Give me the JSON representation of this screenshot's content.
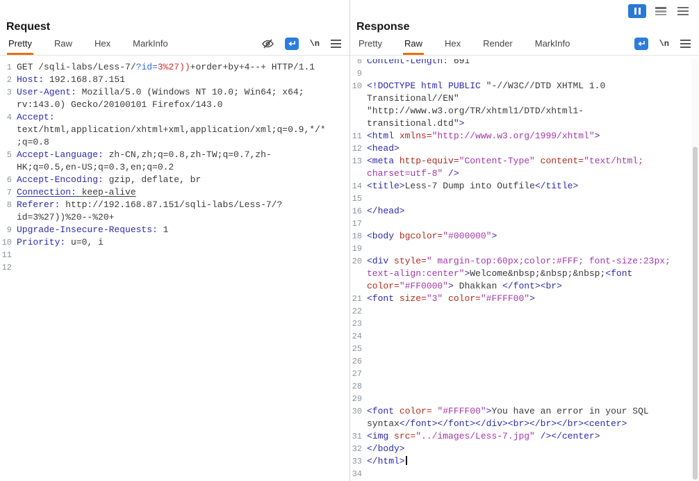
{
  "window": {
    "controls": {
      "pause_icon": "pause-icon",
      "layout_icon": "layout-rows-icon",
      "menu_icon": "menu-icon",
      "pause_button_bg": "#2878d8"
    }
  },
  "colors": {
    "tab_active_underline": "#e8700e",
    "wrap_icon_bg": "#2b7de0",
    "header_name": "#2b2bb0",
    "tag": "#2b2bb0",
    "attribute": "#b22a1d",
    "string": "#a437ad",
    "param_name": "#2f6fd3",
    "param_value": "#d22d2d",
    "plain_text": "#3a3a3a",
    "line_number": "#8d95a0"
  },
  "request": {
    "title": "Request",
    "tabs": [
      {
        "label": "Pretty",
        "active": true
      },
      {
        "label": "Raw",
        "active": false
      },
      {
        "label": "Hex",
        "active": false
      },
      {
        "label": "MarkInfo",
        "active": false
      }
    ],
    "toolbar": {
      "icons": [
        "eye-off-icon",
        "wrap-icon",
        "newline-icon",
        "menu-icon"
      ],
      "newline_label": "\\n"
    },
    "lines": [
      {
        "n": "1",
        "segs": [
          {
            "t": "GET /sqli-labs/Less-7/",
            "c": "plain"
          },
          {
            "t": "?id=",
            "c": "pname"
          },
          {
            "t": "3%27))",
            "c": "pvalue"
          },
          {
            "t": "+order+by+4--+ HTTP/1.1",
            "c": "plain"
          }
        ]
      },
      {
        "n": "2",
        "segs": [
          {
            "t": "Host:",
            "c": "hname"
          },
          {
            "t": " 192.168.87.151",
            "c": "plain"
          }
        ]
      },
      {
        "n": "3",
        "segs": [
          {
            "t": "User-Agent:",
            "c": "hname"
          },
          {
            "t": " Mozilla/5.0 (Windows NT 10.0; Win64; x64; rv:143.0) Gecko/20100101 Firefox/143.0",
            "c": "plain"
          }
        ]
      },
      {
        "n": "4",
        "segs": [
          {
            "t": "Accept:",
            "c": "hname"
          },
          {
            "t": " text/html,application/xhtml+xml,application/xml;q=0.9,*/*;q=0.8",
            "c": "plain"
          }
        ]
      },
      {
        "n": "5",
        "segs": [
          {
            "t": "Accept-Language:",
            "c": "hname"
          },
          {
            "t": " zh-CN,zh;q=0.8,zh-TW;q=0.7,zh-HK;q=0.5,en-US;q=0.3,en;q=0.2",
            "c": "plain"
          }
        ]
      },
      {
        "n": "6",
        "segs": [
          {
            "t": "Accept-Encoding:",
            "c": "hname"
          },
          {
            "t": " gzip, deflate, br",
            "c": "plain"
          }
        ]
      },
      {
        "n": "7",
        "segs": [
          {
            "t": "Connection:",
            "c": "hname u"
          },
          {
            "t": " keep-alive",
            "c": "plain u"
          }
        ]
      },
      {
        "n": "8",
        "segs": [
          {
            "t": "Referer:",
            "c": "hname"
          },
          {
            "t": " http://192.168.87.151/sqli-labs/Less-7/?id=3%27))%20--%20+",
            "c": "plain"
          }
        ]
      },
      {
        "n": "9",
        "segs": [
          {
            "t": "Upgrade-Insecure-Requests:",
            "c": "hname"
          },
          {
            "t": " 1",
            "c": "plain"
          }
        ]
      },
      {
        "n": "10",
        "segs": [
          {
            "t": "Priority:",
            "c": "hname"
          },
          {
            "t": " u=0, i",
            "c": "plain"
          }
        ]
      },
      {
        "n": "11",
        "segs": []
      },
      {
        "n": "12",
        "segs": []
      }
    ]
  },
  "response": {
    "title": "Response",
    "tabs": [
      {
        "label": "Pretty",
        "active": false
      },
      {
        "label": "Raw",
        "active": true
      },
      {
        "label": "Hex",
        "active": false
      },
      {
        "label": "Render",
        "active": false
      },
      {
        "label": "MarkInfo",
        "active": false
      }
    ],
    "toolbar": {
      "icons": [
        "wrap-icon",
        "newline-icon",
        "menu-icon"
      ],
      "newline_label": "\\n"
    },
    "lines": [
      {
        "n": "8",
        "segs": [
          {
            "t": "Content-Length:",
            "c": "hname"
          },
          {
            "t": " 691",
            "c": "plain"
          }
        ]
      },
      {
        "n": "9",
        "segs": []
      },
      {
        "n": "10",
        "segs": [
          {
            "t": "<!DOCTYPE html PUBLIC ",
            "c": "tag"
          },
          {
            "t": "\"-//W3C//DTD XHTML 1.0 Transitional//EN\" \"http://www.w3.org/TR/xhtml1/DTD/xhtml1-transitional.dtd\"",
            "c": "plain"
          },
          {
            "t": ">",
            "c": "tag"
          }
        ]
      },
      {
        "n": "11",
        "segs": [
          {
            "t": "<html ",
            "c": "tag"
          },
          {
            "t": "xmlns=",
            "c": "attr"
          },
          {
            "t": "\"http://www.w3.org/1999/xhtml\"",
            "c": "str"
          },
          {
            "t": ">",
            "c": "tag"
          }
        ]
      },
      {
        "n": "12",
        "segs": [
          {
            "t": "<head>",
            "c": "tag"
          }
        ]
      },
      {
        "n": "13",
        "segs": [
          {
            "t": "<meta ",
            "c": "tag"
          },
          {
            "t": "http-equiv=",
            "c": "attr"
          },
          {
            "t": "\"Content-Type\"",
            "c": "str"
          },
          {
            "t": " ",
            "c": "plain"
          },
          {
            "t": "content=",
            "c": "attr"
          },
          {
            "t": "\"text/html; charset=utf-8\"",
            "c": "str"
          },
          {
            "t": " />",
            "c": "tag"
          }
        ]
      },
      {
        "n": "14",
        "segs": [
          {
            "t": "<title>",
            "c": "tag"
          },
          {
            "t": "Less-7 Dump into Outfile",
            "c": "plain"
          },
          {
            "t": "</title>",
            "c": "tag"
          }
        ]
      },
      {
        "n": "15",
        "segs": []
      },
      {
        "n": "16",
        "segs": [
          {
            "t": "</head>",
            "c": "tag"
          }
        ]
      },
      {
        "n": "17",
        "segs": []
      },
      {
        "n": "18",
        "segs": [
          {
            "t": "<body ",
            "c": "tag"
          },
          {
            "t": "bgcolor=",
            "c": "attr"
          },
          {
            "t": "\"#000000\"",
            "c": "str"
          },
          {
            "t": ">",
            "c": "tag"
          }
        ]
      },
      {
        "n": "19",
        "segs": []
      },
      {
        "n": "20",
        "segs": [
          {
            "t": "<div ",
            "c": "tag"
          },
          {
            "t": "style=",
            "c": "attr"
          },
          {
            "t": "\" margin-top:60px;color:#FFF; font-size:23px; text-align:center\"",
            "c": "str"
          },
          {
            "t": ">",
            "c": "tag"
          },
          {
            "t": "Welcome&nbsp;&nbsp;&nbsp;",
            "c": "plain"
          },
          {
            "t": "<font ",
            "c": "tag"
          },
          {
            "t": "color=",
            "c": "attr"
          },
          {
            "t": "\"#FF0000\"",
            "c": "str"
          },
          {
            "t": ">",
            "c": "tag"
          },
          {
            "t": " Dhakkan ",
            "c": "plain"
          },
          {
            "t": "</font>",
            "c": "tag"
          },
          {
            "t": "<br>",
            "c": "tag"
          }
        ]
      },
      {
        "n": "21",
        "segs": [
          {
            "t": "<font ",
            "c": "tag"
          },
          {
            "t": "size=",
            "c": "attr"
          },
          {
            "t": "\"3\"",
            "c": "str"
          },
          {
            "t": " ",
            "c": "plain"
          },
          {
            "t": "color=",
            "c": "attr"
          },
          {
            "t": "\"#FFFF00\"",
            "c": "str"
          },
          {
            "t": ">",
            "c": "tag"
          }
        ]
      },
      {
        "n": "22",
        "segs": []
      },
      {
        "n": "23",
        "segs": []
      },
      {
        "n": "24",
        "segs": []
      },
      {
        "n": "25",
        "segs": []
      },
      {
        "n": "26",
        "segs": []
      },
      {
        "n": "27",
        "segs": []
      },
      {
        "n": "28",
        "segs": []
      },
      {
        "n": "29",
        "segs": []
      },
      {
        "n": "30",
        "segs": [
          {
            "t": "<font ",
            "c": "tag"
          },
          {
            "t": "color=",
            "c": "attr"
          },
          {
            "t": " \"#FFFF00\"",
            "c": "str"
          },
          {
            "t": ">",
            "c": "tag"
          },
          {
            "t": "You have an error in your SQL syntax",
            "c": "plain"
          },
          {
            "t": "</font></font></div><br></br></br><center>",
            "c": "tag"
          }
        ]
      },
      {
        "n": "31",
        "segs": [
          {
            "t": "<img ",
            "c": "tag"
          },
          {
            "t": "src=",
            "c": "attr"
          },
          {
            "t": "\"../images/Less-7.jpg\"",
            "c": "str"
          },
          {
            "t": " />",
            "c": "tag"
          },
          {
            "t": "</center>",
            "c": "tag"
          }
        ]
      },
      {
        "n": "32",
        "segs": [
          {
            "t": "</body>",
            "c": "tag"
          }
        ]
      },
      {
        "n": "33",
        "segs": [
          {
            "t": "</html>",
            "c": "tag"
          }
        ],
        "cursor": true
      },
      {
        "n": "34",
        "segs": []
      }
    ]
  }
}
